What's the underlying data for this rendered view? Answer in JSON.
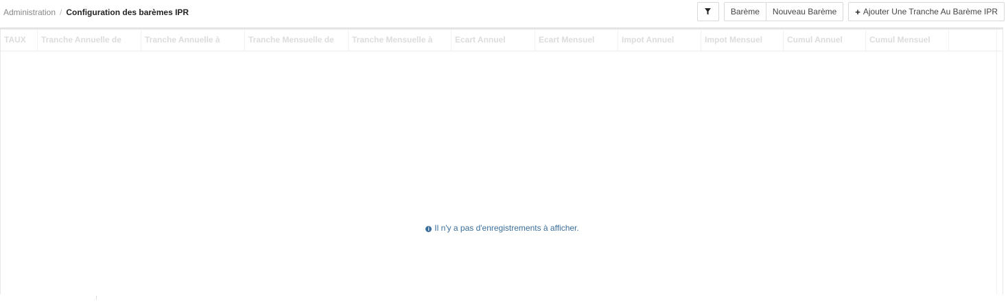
{
  "breadcrumb": {
    "parent": "Administration",
    "separator": "/",
    "current": "Configuration des barèmes IPR"
  },
  "toolbar": {
    "filter_icon": "filter-icon",
    "bareme_label": "Barème",
    "nouveau_bareme_label": "Nouveau Barème",
    "add_icon": "plus-icon",
    "add_tranche_label": "Ajouter Une Tranche Au Barème IPR"
  },
  "table": {
    "columns": [
      "TAUX",
      "Tranche Annuelle de",
      "Tranche Annuelle à",
      "Tranche Mensuelle de",
      "Tranche Mensuelle à",
      "Ecart Annuel",
      "Ecart Mensuel",
      "Impot Annuel",
      "Impot Mensuel",
      "Cumul Annuel",
      "Cumul Mensuel"
    ],
    "empty_icon": "info-icon",
    "empty_message": "Il n'y a pas d'enregistrements à afficher."
  }
}
